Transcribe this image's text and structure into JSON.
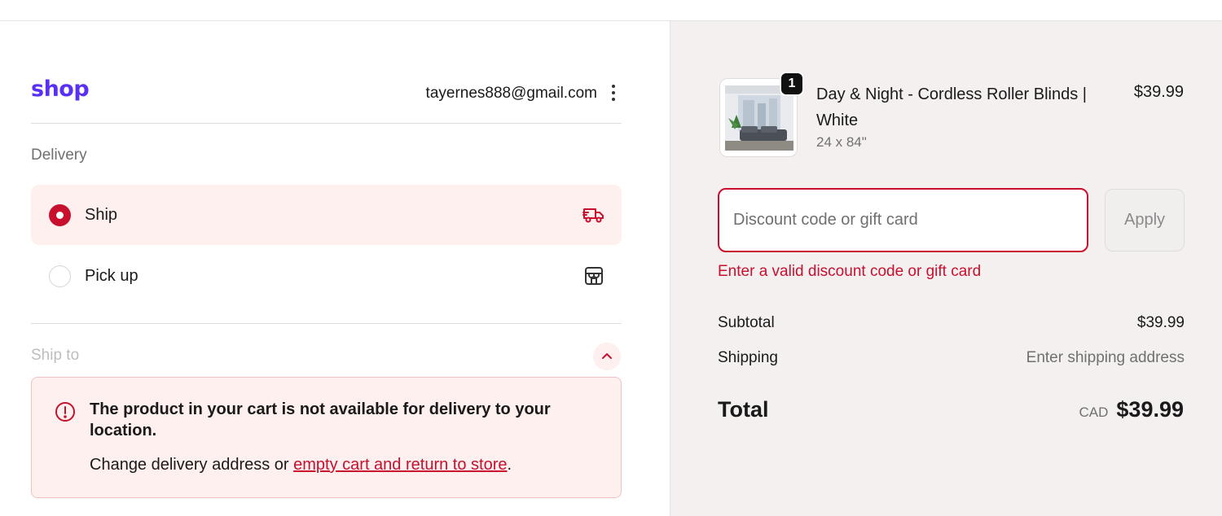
{
  "header": {
    "logo": "shop",
    "email": "tayernes888@gmail.com"
  },
  "delivery": {
    "label": "Delivery",
    "options": [
      {
        "label": "Ship",
        "selected": true,
        "icon": "truck-icon"
      },
      {
        "label": "Pick up",
        "selected": false,
        "icon": "store-icon"
      }
    ]
  },
  "ship_to": {
    "label": "Ship to",
    "alert": {
      "title": "The product in your cart is not available for delivery to your location.",
      "body_prefix": "Change delivery address or ",
      "link": "empty cart and return to store",
      "body_suffix": "."
    }
  },
  "order": {
    "item": {
      "quantity": "1",
      "name": "Day & Night - Cordless Roller Blinds | White",
      "variant": "24 x 84\"",
      "price": "$39.99"
    },
    "discount": {
      "placeholder": "Discount code or gift card",
      "apply_label": "Apply",
      "error": "Enter a valid discount code or gift card"
    },
    "subtotal_label": "Subtotal",
    "subtotal_value": "$39.99",
    "shipping_label": "Shipping",
    "shipping_value": "Enter shipping address",
    "total_label": "Total",
    "currency": "CAD",
    "total_value": "$39.99"
  },
  "colors": {
    "brand": "#5a31f4",
    "accent": "#c8102e",
    "summary_bg": "#f5f0f0"
  }
}
